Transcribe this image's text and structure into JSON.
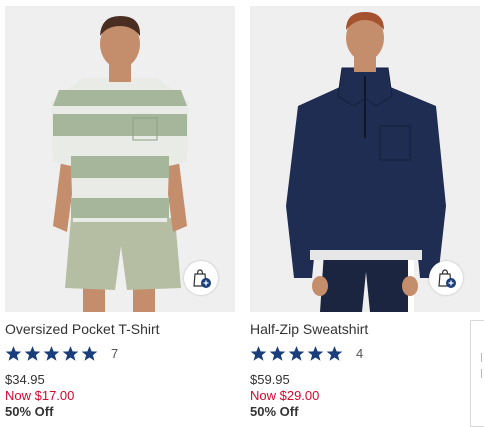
{
  "products": [
    {
      "name": "Oversized Pocket T-Shirt",
      "rating": 5,
      "review_count": "7",
      "original_price": "$34.95",
      "sale_price": "Now $17.00",
      "discount": "50% Off",
      "icon": "shopping-bag-add-icon"
    },
    {
      "name": "Half-Zip Sweatshirt",
      "rating": 5,
      "review_count": "4",
      "original_price": "$59.95",
      "sale_price": "Now $29.00",
      "discount": "50% Off",
      "icon": "shopping-bag-add-icon"
    }
  ],
  "colors": {
    "star": "#1a3d7c",
    "sale_price": "#d00a2c",
    "bag_plus_badge": "#1a3d7c"
  }
}
